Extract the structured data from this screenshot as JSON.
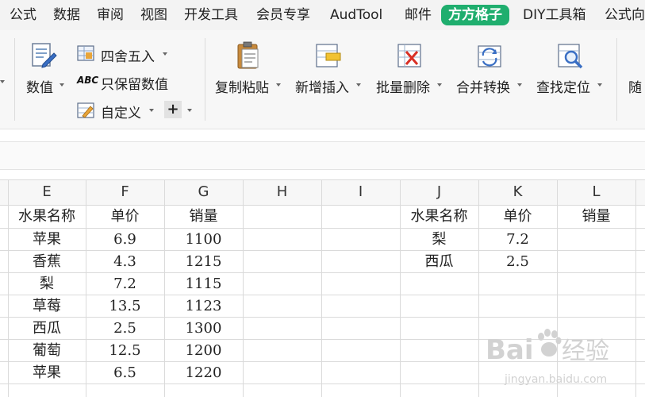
{
  "menu": [
    {
      "label": "公式",
      "active": false
    },
    {
      "label": "数据",
      "active": false
    },
    {
      "label": "审阅",
      "active": false
    },
    {
      "label": "视图",
      "active": false
    },
    {
      "label": "开发工具",
      "active": false
    },
    {
      "label": "会员专享",
      "active": false
    },
    {
      "label": "AudTool",
      "active": false
    },
    {
      "label": "邮件",
      "active": false
    },
    {
      "label": "方方格子",
      "active": true
    },
    {
      "label": "DIY工具箱",
      "active": false
    },
    {
      "label": "公式向",
      "active": false
    }
  ],
  "ribbon": {
    "values_label": "数值",
    "round_label": "四舍五入",
    "keep_values_label": "只保留数值",
    "custom_label": "自定义",
    "plus_label": "+",
    "abc_icon_text": "ABC",
    "copy_paste_label": "复制粘贴",
    "insert_label": "新增插入",
    "batch_delete_label": "批量删除",
    "merge_convert_label": "合并转换",
    "find_locate_label": "查找定位",
    "random_label": "随"
  },
  "sheet": {
    "columns": [
      "E",
      "F",
      "G",
      "H",
      "I",
      "J",
      "K",
      "L"
    ],
    "table1": {
      "headers": [
        "水果名称",
        "单价",
        "销量"
      ],
      "rows": [
        [
          "苹果",
          "6.9",
          "1100"
        ],
        [
          "香蕉",
          "4.3",
          "1215"
        ],
        [
          "梨",
          "7.2",
          "1115"
        ],
        [
          "草莓",
          "13.5",
          "1123"
        ],
        [
          "西瓜",
          "2.5",
          "1300"
        ],
        [
          "葡萄",
          "12.5",
          "1200"
        ],
        [
          "苹果",
          "6.5",
          "1220"
        ]
      ]
    },
    "table2": {
      "headers": [
        "水果名称",
        "单价",
        "销量"
      ],
      "rows": [
        [
          "梨",
          "7.2",
          ""
        ],
        [
          "西瓜",
          "2.5",
          ""
        ]
      ]
    }
  },
  "watermark": {
    "brand": "Bai",
    "brand_suffix": "经验",
    "url": "jingyan.baidu.com"
  },
  "colors": {
    "accent": "#1fae6e",
    "grid_line": "#dadada",
    "watermark": "#d0d0d0"
  }
}
